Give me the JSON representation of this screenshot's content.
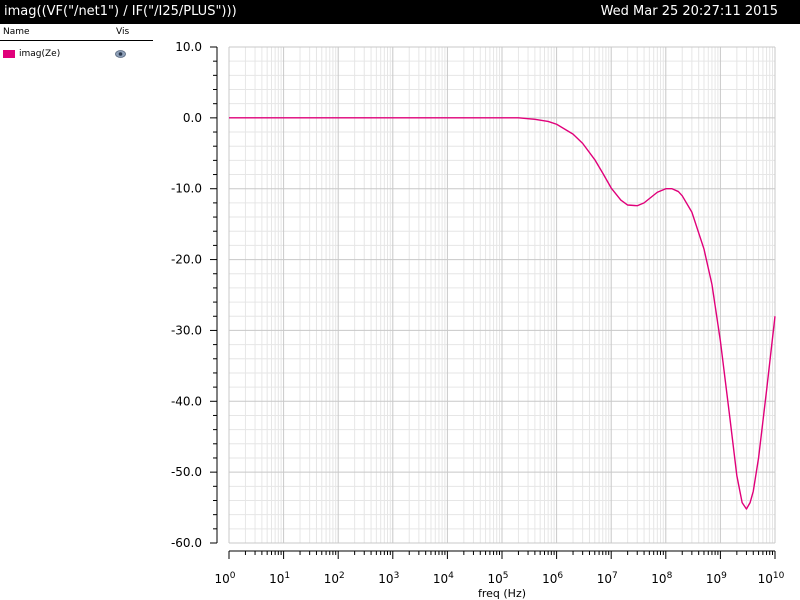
{
  "window": {
    "title": "imag((VF(\"/net1\") / IF(\"/I25/PLUS\")))",
    "timestamp": "Wed Mar 25 20:27:11 2015"
  },
  "legend": {
    "header_name": "Name",
    "header_vis": "Vis",
    "items": [
      {
        "label": "imag(Ze)",
        "color": "#e0007a",
        "visibility_icon": "eye-icon"
      }
    ]
  },
  "chart_data": {
    "type": "line",
    "xlabel": "freq (Hz)",
    "ylabel": "",
    "x_scale": "log",
    "xlim": [
      1,
      10000000000
    ],
    "ylim": [
      -60,
      10
    ],
    "grid": true,
    "x_tick_exponents": [
      0,
      1,
      2,
      3,
      4,
      5,
      6,
      7,
      8,
      9,
      10
    ],
    "y_tick_labels": [
      "10.0",
      "0.0",
      "-10.0",
      "-20.0",
      "-30.0",
      "-40.0",
      "-50.0",
      "-60.0"
    ],
    "series": [
      {
        "name": "imag(Ze)",
        "color": "#e0007a",
        "x": [
          1,
          10,
          100,
          1000,
          10000,
          100000,
          200000,
          400000,
          700000,
          1000000,
          2000000,
          3000000,
          5000000,
          7000000,
          10000000,
          15000000,
          20000000,
          30000000,
          40000000,
          50000000,
          70000000,
          100000000,
          130000000,
          170000000,
          200000000,
          300000000,
          500000000,
          700000000,
          1000000000,
          1500000000,
          2000000000,
          2500000000,
          3000000000,
          3500000000,
          4000000000,
          5000000000,
          7000000000,
          10000000000
        ],
        "y": [
          0,
          0,
          0,
          0,
          0,
          0,
          0,
          -0.2,
          -0.5,
          -0.9,
          -2.3,
          -3.6,
          -5.9,
          -7.8,
          -9.9,
          -11.6,
          -12.3,
          -12.4,
          -12.0,
          -11.4,
          -10.5,
          -10.0,
          -10.0,
          -10.4,
          -11.0,
          -13.3,
          -18.5,
          -23.5,
          -31.5,
          -42.5,
          -50.5,
          -54.3,
          -55.2,
          -54.3,
          -52.7,
          -48.0,
          -38.5,
          -28.0
        ]
      }
    ]
  }
}
